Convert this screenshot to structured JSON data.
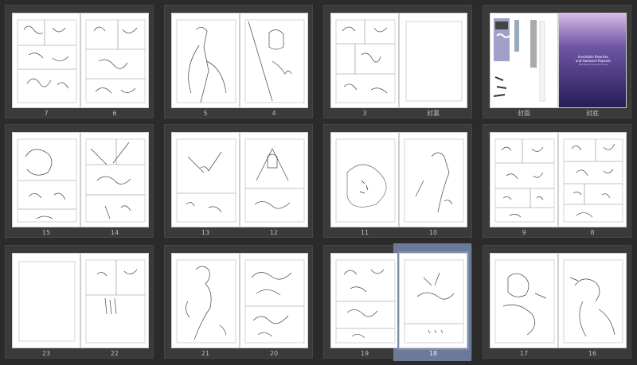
{
  "spreads": [
    {
      "left": "7",
      "right": "6"
    },
    {
      "left": "5",
      "right": "4"
    },
    {
      "left": "3",
      "right": "封裏"
    },
    {
      "left": "封面",
      "right": "封底"
    },
    {
      "left": "15",
      "right": "14"
    },
    {
      "left": "13",
      "right": "12"
    },
    {
      "left": "11",
      "right": "10"
    },
    {
      "left": "9",
      "right": "8"
    },
    {
      "left": "23",
      "right": "22"
    },
    {
      "left": "21",
      "right": "20"
    },
    {
      "left": "19",
      "right": "18"
    },
    {
      "left": "17",
      "right": "16"
    }
  ],
  "selected_page": "18",
  "cover_text": {
    "line1": "Inevitable Rewrites",
    "line2": "and Awkward Repeats",
    "line3": "the Mourning Arm Circle"
  },
  "colors": {
    "background": "#2b2b2b",
    "spread_bg": "#3a3a3a",
    "selection": "#6a7a98",
    "cover_purple": "#3c2c6a"
  }
}
